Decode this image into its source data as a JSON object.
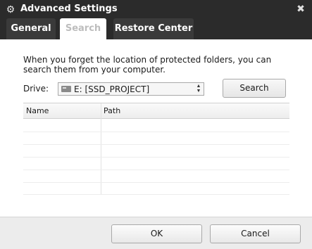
{
  "window": {
    "title": "Advanced Settings",
    "icon": "gear-icon",
    "close_glyph": "✖"
  },
  "tabs": [
    {
      "label": "General",
      "active": false
    },
    {
      "label": "Search",
      "active": true
    },
    {
      "label": "Restore Center",
      "active": false
    }
  ],
  "search": {
    "description": "When you forget the location of protected folders, you can search them from your computer.",
    "drive_label": "Drive:",
    "drive_value": "E: [SSD_PROJECT]",
    "drive_icon": "hard-drive-icon",
    "search_button": "Search"
  },
  "results": {
    "columns": [
      "Name",
      "Path"
    ],
    "rows": []
  },
  "footer": {
    "ok_label": "OK",
    "cancel_label": "Cancel"
  }
}
